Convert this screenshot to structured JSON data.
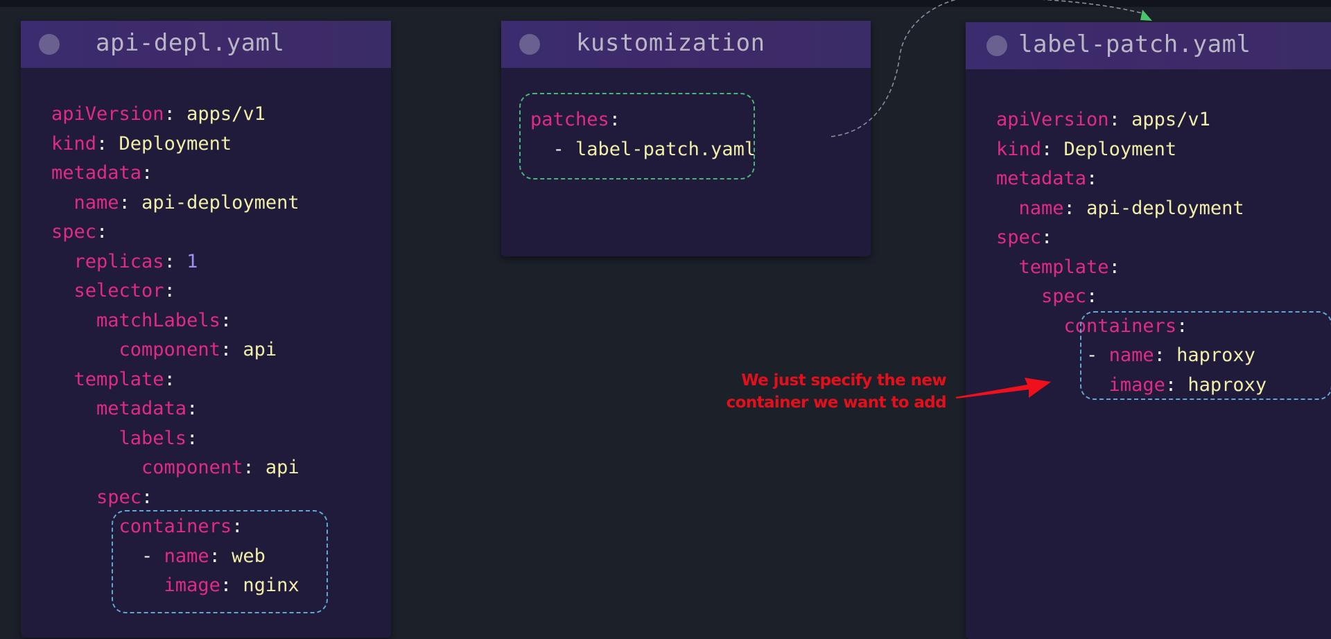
{
  "panels": {
    "api_depl": {
      "title": "api-depl.yaml",
      "lines": [
        [
          {
            "t": "k",
            "s": "apiVersion"
          },
          {
            "t": "c",
            "s": ": "
          },
          {
            "t": "v",
            "s": "apps/v1"
          }
        ],
        [
          {
            "t": "k",
            "s": "kind"
          },
          {
            "t": "c",
            "s": ": "
          },
          {
            "t": "v",
            "s": "Deployment"
          }
        ],
        [
          {
            "t": "k",
            "s": "metadata"
          },
          {
            "t": "c",
            "s": ":"
          }
        ],
        [
          {
            "t": "k",
            "s": "  name"
          },
          {
            "t": "c",
            "s": ": "
          },
          {
            "t": "v",
            "s": "api-deployment"
          }
        ],
        [
          {
            "t": "k",
            "s": "spec"
          },
          {
            "t": "c",
            "s": ":"
          }
        ],
        [
          {
            "t": "k",
            "s": "  replicas"
          },
          {
            "t": "c",
            "s": ": "
          },
          {
            "t": "n",
            "s": "1"
          }
        ],
        [
          {
            "t": "k",
            "s": "  selector"
          },
          {
            "t": "c",
            "s": ":"
          }
        ],
        [
          {
            "t": "k",
            "s": "    matchLabels"
          },
          {
            "t": "c",
            "s": ":"
          }
        ],
        [
          {
            "t": "k",
            "s": "      component"
          },
          {
            "t": "c",
            "s": ": "
          },
          {
            "t": "v",
            "s": "api"
          }
        ],
        [
          {
            "t": "k",
            "s": "  template"
          },
          {
            "t": "c",
            "s": ":"
          }
        ],
        [
          {
            "t": "k",
            "s": "    metadata"
          },
          {
            "t": "c",
            "s": ":"
          }
        ],
        [
          {
            "t": "k",
            "s": "      labels"
          },
          {
            "t": "c",
            "s": ":"
          }
        ],
        [
          {
            "t": "k",
            "s": "        component"
          },
          {
            "t": "c",
            "s": ": "
          },
          {
            "t": "v",
            "s": "api"
          }
        ],
        [
          {
            "t": "k",
            "s": "    spec"
          },
          {
            "t": "c",
            "s": ":"
          }
        ],
        [
          {
            "t": "k",
            "s": "      containers"
          },
          {
            "t": "c",
            "s": ":"
          }
        ],
        [
          {
            "t": "d",
            "s": "        - "
          },
          {
            "t": "k",
            "s": "name"
          },
          {
            "t": "c",
            "s": ": "
          },
          {
            "t": "v",
            "s": "web"
          }
        ],
        [
          {
            "t": "k",
            "s": "          image"
          },
          {
            "t": "c",
            "s": ": "
          },
          {
            "t": "v",
            "s": "nginx"
          }
        ]
      ]
    },
    "kustomization": {
      "title": "kustomization",
      "lines": [
        [
          {
            "t": "k",
            "s": "patches"
          },
          {
            "t": "c",
            "s": ":"
          }
        ],
        [
          {
            "t": "d",
            "s": "  - "
          },
          {
            "t": "v",
            "s": "label-patch.yaml"
          }
        ]
      ]
    },
    "label_patch": {
      "title": "label-patch.yaml",
      "lines": [
        [
          {
            "t": "k",
            "s": "apiVersion"
          },
          {
            "t": "c",
            "s": ": "
          },
          {
            "t": "v",
            "s": "apps/v1"
          }
        ],
        [
          {
            "t": "k",
            "s": "kind"
          },
          {
            "t": "c",
            "s": ": "
          },
          {
            "t": "v",
            "s": "Deployment"
          }
        ],
        [
          {
            "t": "k",
            "s": "metadata"
          },
          {
            "t": "c",
            "s": ":"
          }
        ],
        [
          {
            "t": "k",
            "s": "  name"
          },
          {
            "t": "c",
            "s": ": "
          },
          {
            "t": "v",
            "s": "api-deployment"
          }
        ],
        [
          {
            "t": "k",
            "s": "spec"
          },
          {
            "t": "c",
            "s": ":"
          }
        ],
        [
          {
            "t": "k",
            "s": "  template"
          },
          {
            "t": "c",
            "s": ":"
          }
        ],
        [
          {
            "t": "k",
            "s": "    spec"
          },
          {
            "t": "c",
            "s": ":"
          }
        ],
        [
          {
            "t": "k",
            "s": "      containers"
          },
          {
            "t": "c",
            "s": ":"
          }
        ],
        [
          {
            "t": "d",
            "s": "        - "
          },
          {
            "t": "k",
            "s": "name"
          },
          {
            "t": "c",
            "s": ": "
          },
          {
            "t": "v",
            "s": "haproxy"
          }
        ],
        [
          {
            "t": "k",
            "s": "          image"
          },
          {
            "t": "c",
            "s": ": "
          },
          {
            "t": "v",
            "s": "haproxy"
          }
        ]
      ]
    }
  },
  "annotation": {
    "line1": "We just specify the new",
    "line2": "container we want to add"
  },
  "colors": {
    "key": "#e02b86",
    "value": "#f1eea8",
    "number": "#9b93f0",
    "highlight_blue": "#5fa8d3",
    "highlight_green": "#49b57b",
    "annotation_red": "#e3101c",
    "connector_arrow": "#4cc46a"
  }
}
